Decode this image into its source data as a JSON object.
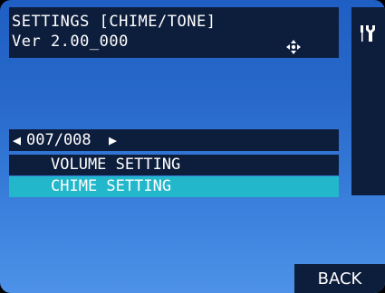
{
  "header": {
    "title": "SETTINGS [CHIME/TONE]",
    "version": "Ver 2.00_000",
    "move_icon": "move-arrows-icon"
  },
  "sidebar": {
    "icon": "tools-icon"
  },
  "pager": {
    "prev_glyph": "◀",
    "text": "007/008",
    "next_glyph": "▶"
  },
  "menu": {
    "items": [
      {
        "label": "VOLUME SETTING",
        "selected": false
      },
      {
        "label": "CHIME SETTING",
        "selected": true
      }
    ]
  },
  "footer": {
    "back_label": "BACK"
  },
  "colors": {
    "panel": "#0d1d3c",
    "selection": "#22b7cb",
    "background_top": "#1f5fc3",
    "background_bottom": "#4d92e8",
    "text": "#ffffff"
  }
}
